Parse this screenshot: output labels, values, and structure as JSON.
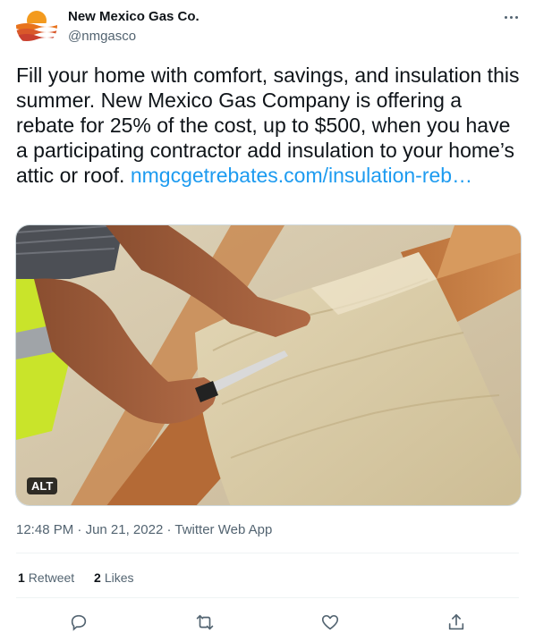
{
  "author": {
    "name": "New Mexico Gas Co.",
    "handle": "@nmgasco",
    "avatar_icon": "nmgas-sunset-logo"
  },
  "tweet": {
    "text": "Fill your home with comfort, savings, and insulation this summer. New Mexico Gas Company is offering a rebate for 25% of the cost, up to $500, when you have a participating contractor add insulation to your home’s attic or roof. ",
    "link_text": "nmgcgetrebates.com/insulation-reb…",
    "link_color": "#1d9bf0"
  },
  "media": {
    "alt_label": "ALT",
    "description_icon": "insulation-photo"
  },
  "meta": {
    "time": "12:48 PM",
    "separator": " · ",
    "date": "Jun 21, 2022",
    "source": "Twitter Web App"
  },
  "stats": {
    "retweets_count": "1",
    "retweets_label": "Retweet",
    "likes_count": "2",
    "likes_label": "Likes"
  },
  "actions": {
    "reply_icon": "reply-icon",
    "retweet_icon": "retweet-icon",
    "like_icon": "heart-icon",
    "share_icon": "share-icon"
  },
  "colors": {
    "text": "#0f1419",
    "secondary": "#536471",
    "accent": "#1d9bf0",
    "divider": "#eff3f4"
  }
}
